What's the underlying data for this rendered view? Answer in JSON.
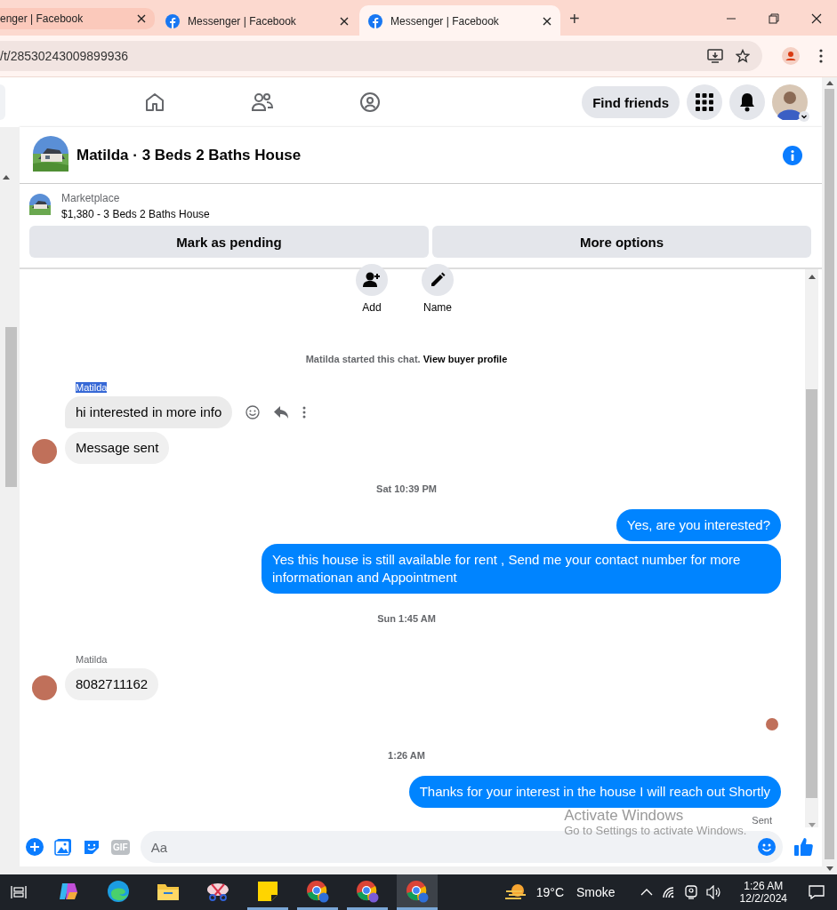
{
  "browser": {
    "tabs": [
      {
        "title": "enger | Facebook",
        "selected": false,
        "icon": false
      },
      {
        "title": "Messenger | Facebook",
        "selected": false,
        "icon": true
      },
      {
        "title": "Messenger | Facebook",
        "selected": true,
        "icon": true
      }
    ],
    "new_tab": "+",
    "url": "/t/28530243009899936"
  },
  "nav": {
    "find_friends": "Find friends"
  },
  "chat": {
    "title": "Matilda · 3 Beds 2 Baths House",
    "marketplace_label": "Marketplace",
    "listing": "$1,380 - 3 Beds 2 Baths House",
    "buttons": [
      "Mark as pending",
      "More options"
    ],
    "actions": [
      "Add",
      "Name"
    ],
    "started": "Matilda started this chat.",
    "view_profile": "View buyer profile"
  },
  "messages": [
    {
      "kind": "sender",
      "text": "Matilda",
      "selected": true
    },
    {
      "kind": "incoming",
      "text": "hi interested in more info",
      "avatar": false,
      "hovered": true
    },
    {
      "kind": "incoming",
      "text": "Message sent",
      "avatar": true,
      "hovered": false
    },
    {
      "kind": "time",
      "text": "Sat 10:39 PM"
    },
    {
      "kind": "outgoing",
      "text": "Yes, are you interested?"
    },
    {
      "kind": "outgoing",
      "text": "Yes this house is still available for rent , Send me your contact number for more informationan and Appointment"
    },
    {
      "kind": "time",
      "text": "Sun 1:45 AM"
    },
    {
      "kind": "sender",
      "text": "Matilda",
      "selected": false
    },
    {
      "kind": "incoming",
      "text": "8082711162",
      "avatar": true,
      "hovered": false
    },
    {
      "kind": "seen"
    },
    {
      "kind": "time",
      "text": "1:26 AM"
    },
    {
      "kind": "outgoing",
      "text": "Thanks for your interest in the house I will reach out Shortly"
    },
    {
      "kind": "status",
      "text": "Sent"
    }
  ],
  "composer": {
    "placeholder": "Aa",
    "gif": "GIF"
  },
  "os_notice": {
    "title": "Activate Windows",
    "subtitle": "Go to Settings to activate Windows."
  },
  "taskbar": {
    "apps": [
      {
        "kind": "copilot",
        "running": false,
        "selected": false
      },
      {
        "kind": "edge",
        "running": false,
        "selected": false
      },
      {
        "kind": "folder",
        "running": false,
        "selected": false
      },
      {
        "kind": "snip",
        "running": false,
        "selected": false
      },
      {
        "kind": "notes",
        "running": true,
        "selected": false
      },
      {
        "kind": "chrome",
        "running": true,
        "selected": false
      },
      {
        "kind": "chrome",
        "running": true,
        "selected": false
      },
      {
        "kind": "chrome",
        "running": true,
        "selected": true
      }
    ],
    "temperature": "19°C",
    "weather": "Smoke",
    "time": "1:26 AM",
    "date": "12/2/2024"
  }
}
